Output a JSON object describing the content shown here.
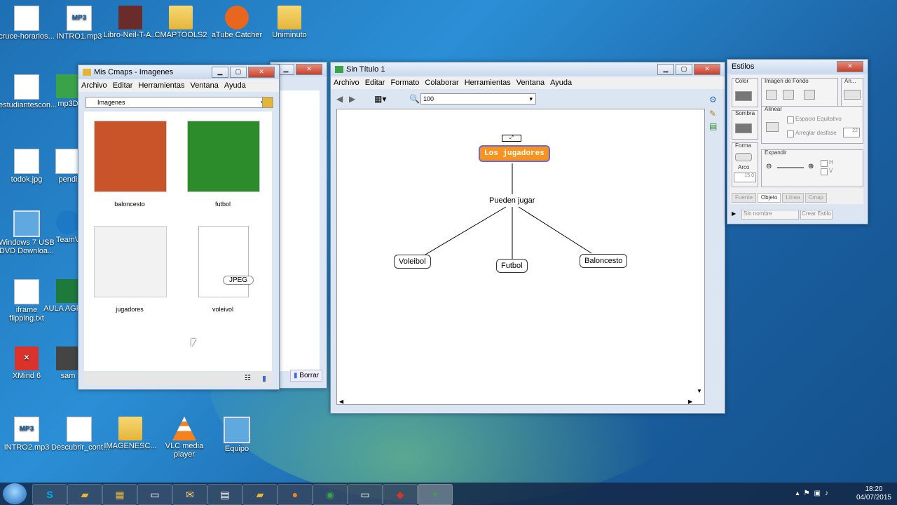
{
  "desktop": {
    "icons": [
      {
        "label": "cruce-horarios...",
        "kind": "doc"
      },
      {
        "label": "INTRO1.mp3",
        "kind": "doc",
        "tag": "MP3"
      },
      {
        "label": "Libro-Neil-T-A...",
        "kind": "book"
      },
      {
        "label": "CMAPTOOLS2",
        "kind": "folder"
      },
      {
        "label": "aTube Catcher",
        "kind": "cam"
      },
      {
        "label": "Uniminuto",
        "kind": "folder"
      },
      {
        "label": "estudiantescon...",
        "kind": "doc"
      },
      {
        "label": "mp3D",
        "kind": "green"
      },
      {
        "label": "todok.jpg",
        "kind": "doc"
      },
      {
        "label": "pendi",
        "kind": "doc"
      },
      {
        "label": "Windows 7 USB DVD Downloa...",
        "kind": "mon"
      },
      {
        "label": "TeamV",
        "kind": "tv"
      },
      {
        "label": "iframe flipping.txt",
        "kind": "doc"
      },
      {
        "label": "AULA AGRED",
        "kind": "xl"
      },
      {
        "label": "XMind 6",
        "kind": "red"
      },
      {
        "label": "sam",
        "kind": "photo"
      },
      {
        "label": "INTRO2.mp3",
        "kind": "doc",
        "tag": "MP3"
      },
      {
        "label": "Descubrir_cont...",
        "kind": "doc"
      },
      {
        "label": "IMAGENESC...",
        "kind": "folder"
      },
      {
        "label": "VLC media player",
        "kind": "vlc"
      },
      {
        "label": "Equipo",
        "kind": "mon"
      }
    ]
  },
  "cmaps_window": {
    "title": "Mis Cmaps - Imagenes",
    "menu": [
      "Archivo",
      "Editar",
      "Herramientas",
      "Ventana",
      "Ayuda"
    ],
    "folder_select": "Imagenes",
    "items": [
      {
        "label": "baloncesto",
        "color": "#c9542a"
      },
      {
        "label": "futbol",
        "color": "#2c8c2c"
      },
      {
        "label": "jugadores",
        "color": "#f2f2f2"
      },
      {
        "label": "voleivol",
        "color": "#ffffff",
        "badge": "JPEG"
      }
    ],
    "behind_button": "Borrar"
  },
  "editor_window": {
    "title": "Sin Título 1",
    "menu": [
      "Archivo",
      "Editar",
      "Formato",
      "Colaborar",
      "Herramientas",
      "Ventana",
      "Ayuda"
    ],
    "zoom": "100",
    "map": {
      "root": "Los jugadores",
      "link": "Pueden jugar",
      "children": [
        "Voleibol",
        "Futbol",
        "Baloncesto"
      ]
    }
  },
  "styles_window": {
    "title": "Estilos",
    "groups": {
      "color": "Color",
      "bg_image": "Imagen de Fondo",
      "an": "An...",
      "shadow": "Sombra",
      "align": "Alinear",
      "equal_space": "Espacio Equitativo",
      "fix_offset": "Arreglar desfase",
      "offset_value": "22",
      "shape": "Forma",
      "expand": "Expandir",
      "arc": "Arco",
      "arc_value": "15.0",
      "h": "H",
      "v": "V"
    },
    "tabs": [
      "Fuente",
      "Objeto",
      "Línea",
      "Cmap"
    ],
    "style_name_placeholder": "Sin nombre",
    "create_style": "Crear Estilo"
  },
  "taskbar": {
    "time": "18:20",
    "date": "04/07/2015"
  }
}
